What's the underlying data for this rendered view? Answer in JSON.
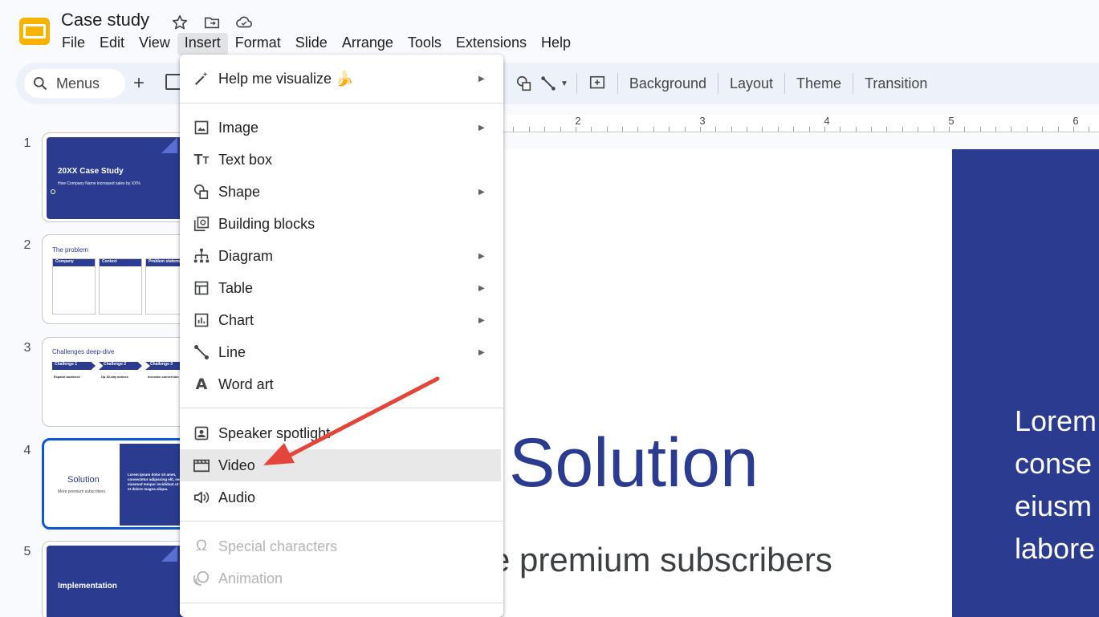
{
  "app": {
    "title": "Case study",
    "menu": [
      "File",
      "Edit",
      "View",
      "Insert",
      "Format",
      "Slide",
      "Arrange",
      "Tools",
      "Extensions",
      "Help"
    ],
    "active_menu": "Insert"
  },
  "toolbar": {
    "search_label": "Menus",
    "buttons": [
      "Background",
      "Layout",
      "Theme",
      "Transition"
    ]
  },
  "ruler": {
    "numbers": [
      "2",
      "3",
      "4",
      "5",
      "6"
    ]
  },
  "slides": [
    {
      "num": "1",
      "title": "20XX Case Study",
      "subtitle": "How Company Name increased sales by XX%"
    },
    {
      "num": "2",
      "title": "The problem",
      "cols": [
        "Company",
        "Context",
        "Problem statement"
      ]
    },
    {
      "num": "3",
      "title": "Challenges deep-dive",
      "cols": [
        "Challenge 1",
        "Challenge 2",
        "Challenge 3"
      ],
      "sub": [
        "Expand audience",
        "Up 30-day actives",
        "Increase conversion"
      ]
    },
    {
      "num": "4",
      "title": "Solution",
      "subtitle": "More premium subscribers",
      "body": "Lorem ipsum dolor sit amet, consectetur adipiscing elit, sed do eiusmod tempor incididunt ut labore et dolore magna aliqua."
    },
    {
      "num": "5",
      "title": "Implementation"
    }
  ],
  "canvas": {
    "title": "Solution",
    "subtitle": "e premium subscribers",
    "lorem_lines": "Lorem\nconse\neiusm\nlabore"
  },
  "insert_menu": {
    "items": [
      {
        "label": "Help me visualize 🍌",
        "icon": "magic-pen-icon",
        "submenu": true
      },
      {
        "label": "Image",
        "icon": "image-icon",
        "submenu": true
      },
      {
        "label": "Text box",
        "icon": "text-box-icon",
        "submenu": false
      },
      {
        "label": "Shape",
        "icon": "shape-icon",
        "submenu": true
      },
      {
        "label": "Building blocks",
        "icon": "building-blocks-icon",
        "submenu": false
      },
      {
        "label": "Diagram",
        "icon": "diagram-icon",
        "submenu": true
      },
      {
        "label": "Table",
        "icon": "table-icon",
        "submenu": true
      },
      {
        "label": "Chart",
        "icon": "chart-icon",
        "submenu": true
      },
      {
        "label": "Line",
        "icon": "line-icon",
        "submenu": true
      },
      {
        "label": "Word art",
        "icon": "word-art-icon",
        "submenu": false
      },
      {
        "label": "Speaker spotlight",
        "icon": "speaker-spotlight-icon",
        "submenu": false
      },
      {
        "label": "Video",
        "icon": "video-icon",
        "submenu": false,
        "highlighted": true
      },
      {
        "label": "Audio",
        "icon": "audio-icon",
        "submenu": false
      },
      {
        "label": "Special characters",
        "icon": "omega-icon",
        "disabled": true
      },
      {
        "label": "Animation",
        "icon": "animation-icon",
        "disabled": true
      }
    ]
  },
  "colors": {
    "navy": "#2b3b8f",
    "highlight": "#e8e8e8",
    "arrow": "#e5443b",
    "accent_blue": "#0b57d0"
  }
}
